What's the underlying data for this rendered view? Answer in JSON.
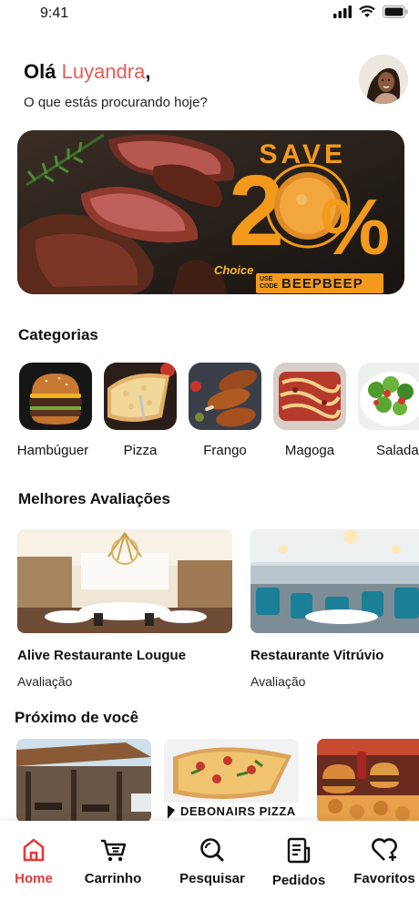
{
  "status": {
    "time": "9:41"
  },
  "greeting": {
    "hello": "Olá",
    "name": "Luyandra",
    "comma": ",",
    "subtitle": "O que estás procurando hoje?"
  },
  "banner": {
    "save": "SAVE",
    "big": "2",
    "percent": "%",
    "choice": "Choice",
    "use_code": "USE CODE",
    "code": "BEEPBEEP"
  },
  "categories": {
    "title": "Categorias",
    "items": [
      {
        "label": "Hambúguer"
      },
      {
        "label": "Pizza"
      },
      {
        "label": "Frango"
      },
      {
        "label": "Magoga"
      },
      {
        "label": "Salada"
      }
    ]
  },
  "top_rated": {
    "title": "Melhores Avaliações",
    "items": [
      {
        "name": "Alive Restaurante Lougue",
        "rating": "Avaliação"
      },
      {
        "name": "Restaurante Vitrúvio",
        "rating": "Avaliação"
      }
    ]
  },
  "nearby": {
    "title": "Próximo de você",
    "brand": "DEBONAIRS PIZZA"
  },
  "nav": {
    "items": [
      {
        "label": "Home",
        "icon": "home-icon"
      },
      {
        "label": "Carrinho",
        "icon": "cart-icon"
      },
      {
        "label": "Pesquisar",
        "icon": "search-icon"
      },
      {
        "label": "Pedidos",
        "icon": "orders-icon"
      },
      {
        "label": "Favoritos",
        "icon": "favorites-icon"
      }
    ]
  },
  "colors": {
    "accent": "#e85b55",
    "active_nav": "#e33b3b",
    "banner_orange": "#f39a1c"
  }
}
